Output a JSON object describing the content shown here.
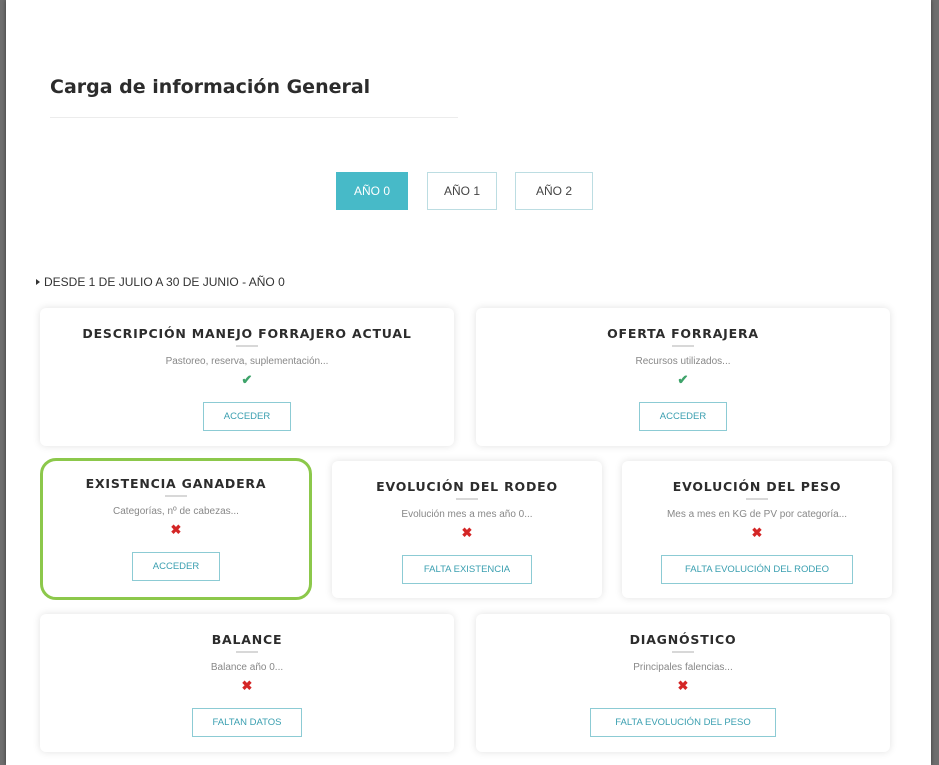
{
  "page": {
    "title": "Carga de información General"
  },
  "tabs": [
    {
      "label": "AÑO 0",
      "active": true
    },
    {
      "label": "AÑO 1",
      "active": false
    },
    {
      "label": "AÑO 2",
      "active": false
    }
  ],
  "range_label": "DESDE 1 DE JULIO A 30 DE JUNIO - AÑO 0",
  "status_icons": {
    "ok": "check-icon",
    "err": "cross-icon"
  },
  "colors": {
    "accent": "#47bac8",
    "highlight_border": "#8cc84b",
    "ok": "#3ea36a",
    "error": "#d42626"
  },
  "cards": [
    {
      "title": "DESCRIPCIÓN MANEJO FORRAJERO ACTUAL",
      "subtitle": "Pastoreo, reserva, suplementación...",
      "status": "ok",
      "button": "ACCEDER"
    },
    {
      "title": "OFERTA FORRAJERA",
      "subtitle": "Recursos utilizados...",
      "status": "ok",
      "button": "ACCEDER"
    },
    {
      "title": "EXISTENCIA GANADERA",
      "subtitle": "Categorías, nº de cabezas...",
      "status": "err",
      "button": "ACCEDER",
      "highlighted": true
    },
    {
      "title": "EVOLUCIÓN DEL RODEO",
      "subtitle": "Evolución mes a mes año 0...",
      "status": "err",
      "button": "FALTA EXISTENCIA"
    },
    {
      "title": "EVOLUCIÓN DEL PESO",
      "subtitle": "Mes a mes en KG de PV por categoría...",
      "status": "err",
      "button": "FALTA EVOLUCIÓN DEL RODEO"
    },
    {
      "title": "BALANCE",
      "subtitle": "Balance año 0...",
      "status": "err",
      "button": "FALTAN DATOS"
    },
    {
      "title": "DIAGNÓSTICO",
      "subtitle": "Principales falencias...",
      "status": "err",
      "button": "FALTA EVOLUCIÓN DEL PESO"
    }
  ]
}
